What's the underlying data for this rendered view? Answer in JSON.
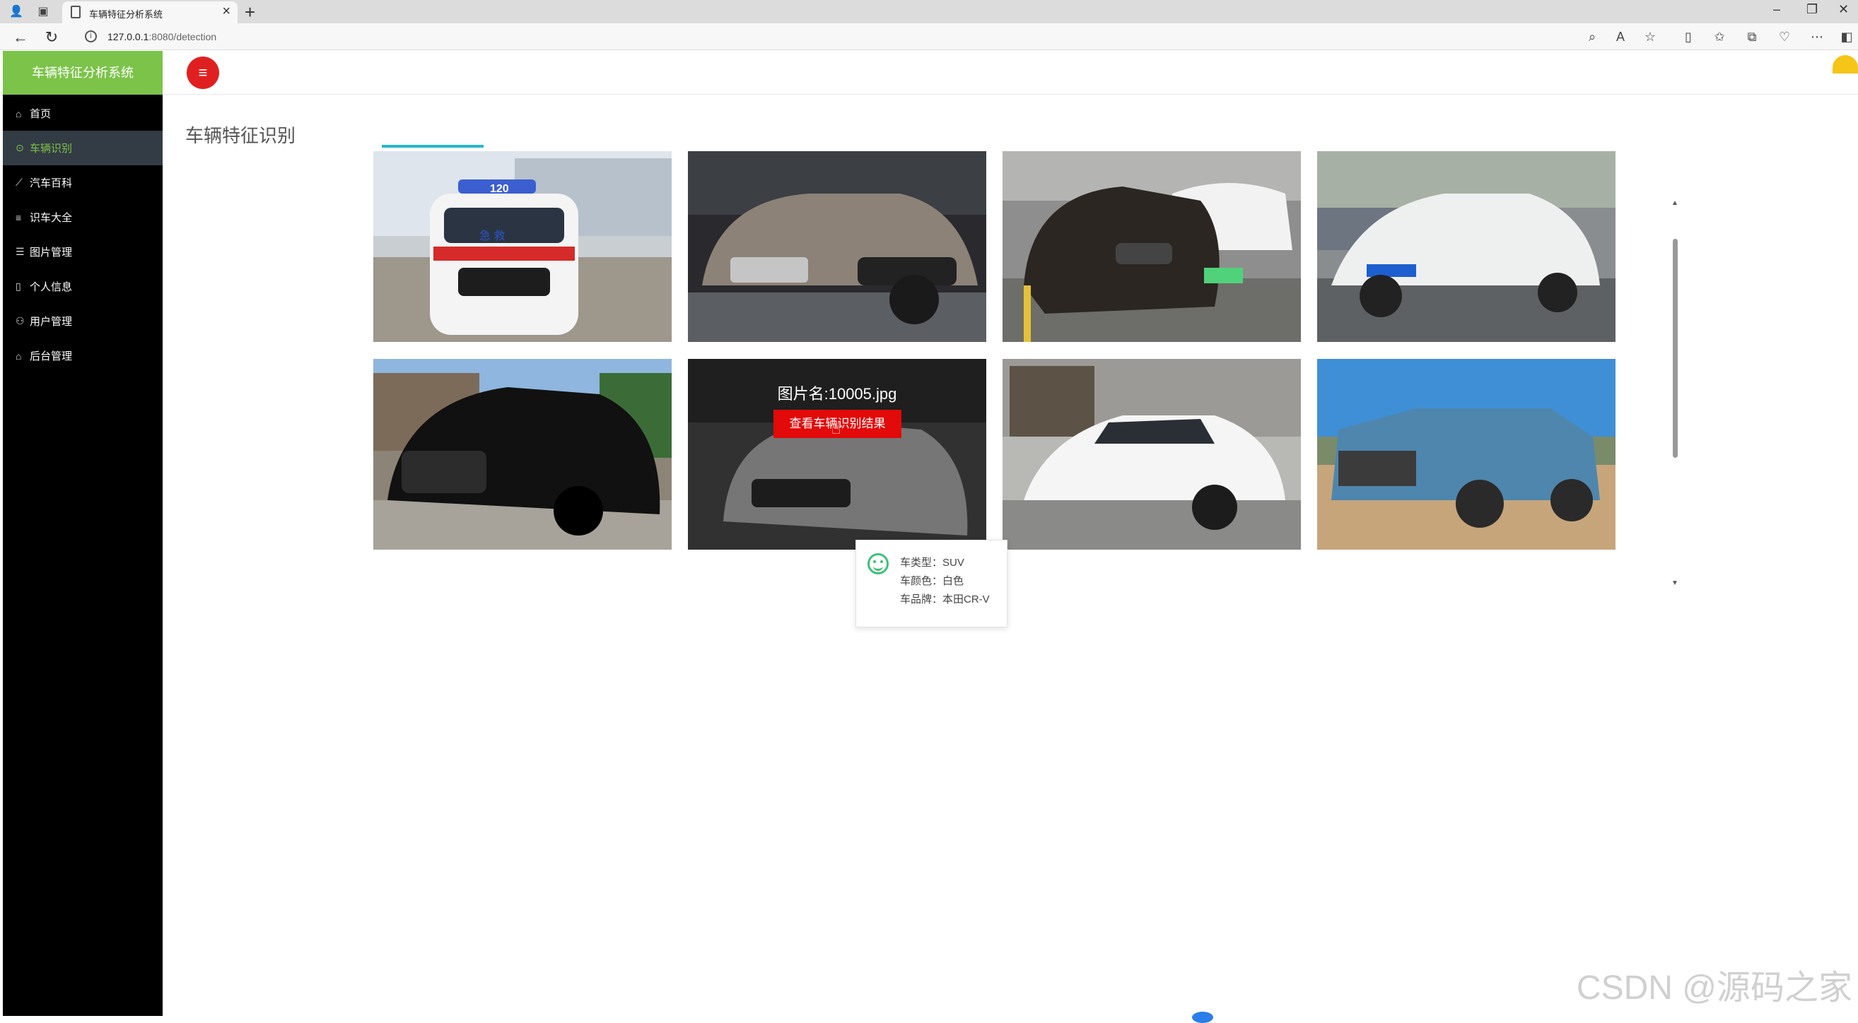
{
  "browser": {
    "tab_title": "车辆特征分析系统",
    "url_host": "127.0.0.1",
    "url_rest": ":8080/detection",
    "new_tab": "+",
    "tab_close": "×",
    "minimize": "–",
    "restore": "❐",
    "close": "✕"
  },
  "app": {
    "brand": "车辆特征分析系统",
    "page_title": "车辆特征识别",
    "menu": [
      {
        "label": "首页",
        "icon": "home-icon"
      },
      {
        "label": "车辆识别",
        "icon": "target-icon",
        "active": true
      },
      {
        "label": "汽车百科",
        "icon": "chart-icon"
      },
      {
        "label": "识车大全",
        "icon": "list-icon"
      },
      {
        "label": "图片管理",
        "icon": "list-icon"
      },
      {
        "label": "个人信息",
        "icon": "phone-icon"
      },
      {
        "label": "用户管理",
        "icon": "users-icon"
      },
      {
        "label": "后台管理",
        "icon": "home-icon"
      }
    ],
    "hovered_card": {
      "name": "图片名:10005.jpg",
      "button": "查看车辆识别结果"
    },
    "popup": {
      "type": "车类型：SUV",
      "color": "车颜色：白色",
      "brand": "车品牌：本田CR-V"
    },
    "watermark": "CSDN @源码之家"
  },
  "cards": [
    {
      "alt": "ambulance",
      "badge": "120",
      "text": "急 救"
    },
    {
      "alt": "grey-bmw"
    },
    {
      "alt": "black-bmw"
    },
    {
      "alt": "white-bmw"
    },
    {
      "alt": "black-mercedes-suv"
    },
    {
      "alt": "white-honda-crv"
    },
    {
      "alt": "white-tesla"
    },
    {
      "alt": "blue-toyota-suv"
    }
  ],
  "colors": {
    "brand_green": "#7cc34a",
    "sidebar_bg": "#000000",
    "button_red": "#e20a0a",
    "accent_teal": "#29b6c9"
  }
}
